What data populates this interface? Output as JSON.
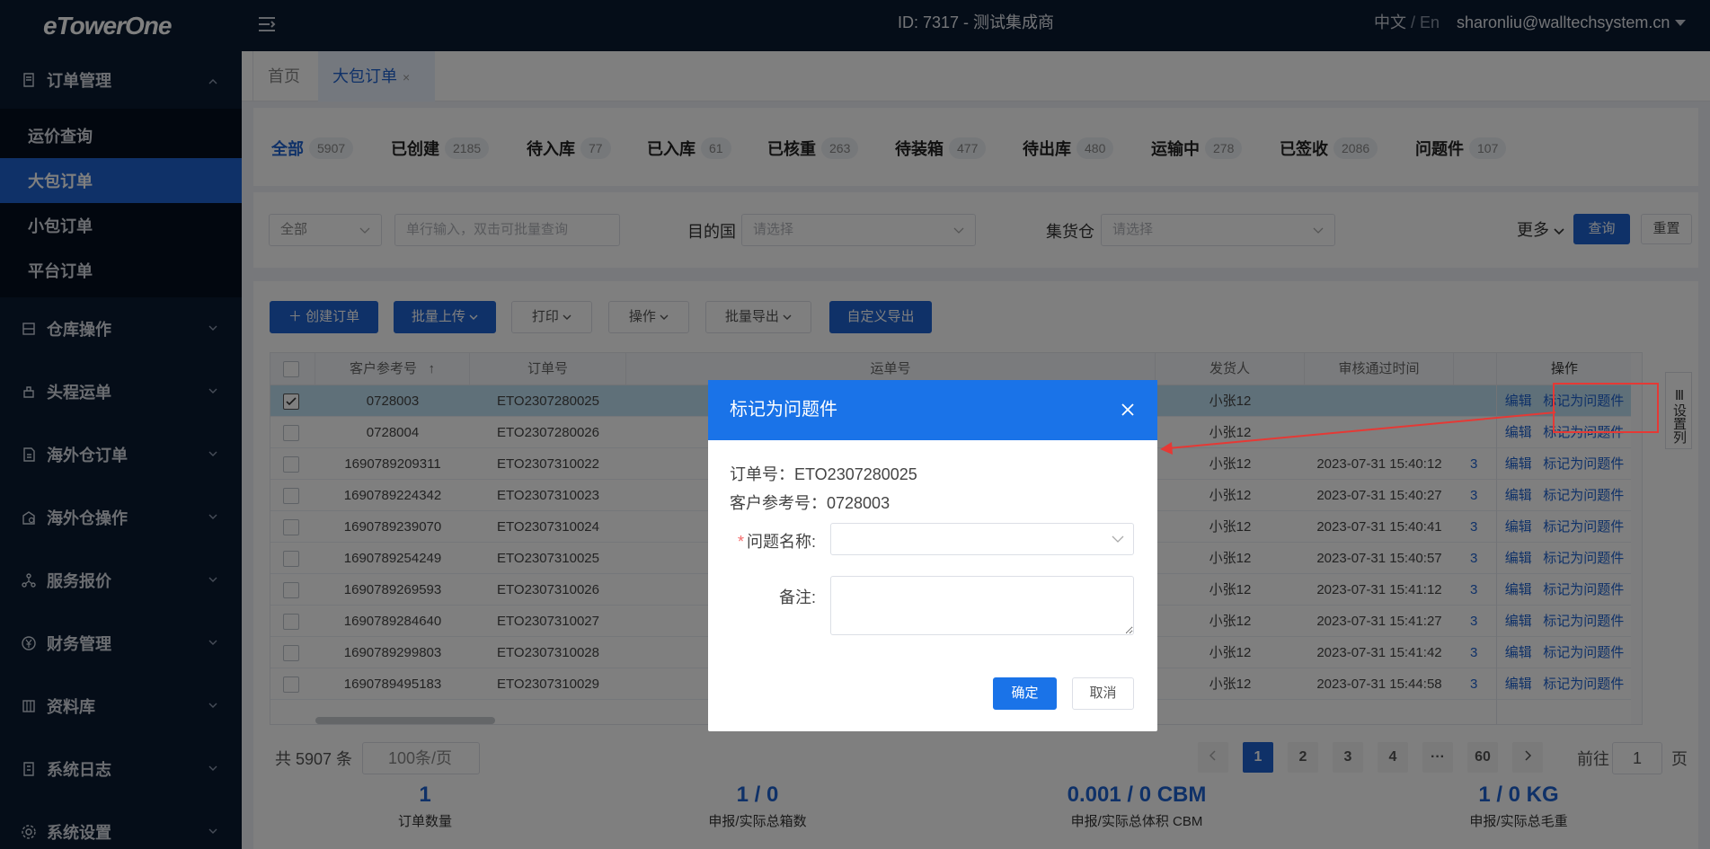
{
  "app": {
    "logo": "eTowerOne",
    "header_title": "ID: 7317 - 测试集成商",
    "lang_zh": "中文",
    "lang_sep": " / ",
    "lang_en": "En",
    "user": "sharonliu@walltechsystem.cn"
  },
  "sidebar": {
    "groups": [
      {
        "label": "订单管理",
        "icon": "receipt-icon",
        "expanded": true
      },
      {
        "label": "仓库操作",
        "icon": "warehouse-icon"
      },
      {
        "label": "头程运单",
        "icon": "ship-icon"
      },
      {
        "label": "海外仓订单",
        "icon": "document-icon"
      },
      {
        "label": "海外仓操作",
        "icon": "warehouse-ops-icon"
      },
      {
        "label": "服务报价",
        "icon": "share-icon"
      },
      {
        "label": "财务管理",
        "icon": "yen-icon"
      },
      {
        "label": "资料库",
        "icon": "database-icon"
      },
      {
        "label": "系统日志",
        "icon": "log-icon"
      },
      {
        "label": "系统设置",
        "icon": "gear-icon"
      }
    ],
    "sub_items": [
      {
        "label": "运价查询"
      },
      {
        "label": "大包订单",
        "active": true
      },
      {
        "label": "小包订单"
      },
      {
        "label": "平台订单"
      }
    ]
  },
  "tabs": {
    "home": "首页",
    "active": "大包订单",
    "close": "×"
  },
  "status_tabs": [
    {
      "label": "全部",
      "count": "5907",
      "active": true
    },
    {
      "label": "已创建",
      "count": "2185"
    },
    {
      "label": "待入库",
      "count": "77"
    },
    {
      "label": "已入库",
      "count": "61"
    },
    {
      "label": "已核重",
      "count": "263"
    },
    {
      "label": "待装箱",
      "count": "477"
    },
    {
      "label": "待出库",
      "count": "480"
    },
    {
      "label": "运输中",
      "count": "278"
    },
    {
      "label": "已签收",
      "count": "2086"
    },
    {
      "label": "问题件",
      "count": "107"
    }
  ],
  "filters": {
    "scope_value": "全部",
    "search_placeholder": "单行输入，双击可批量查询",
    "dest_label": "目的国",
    "dest_placeholder": "请选择",
    "warehouse_label": "集货仓",
    "warehouse_placeholder": "请选择",
    "more": "更多",
    "query": "查询",
    "reset": "重置"
  },
  "toolbar": {
    "create": "＋ 创建订单",
    "bulk_upload": "批量上传",
    "print": "打印",
    "operate": "操作",
    "bulk_export": "批量导出",
    "custom_export": "自定义导出"
  },
  "table": {
    "headers": {
      "ref": "客户参考号",
      "sort": "↑",
      "order": "订单号",
      "waybill": "运单号",
      "shipper": "发货人",
      "approved": "审核通过时间",
      "ops": "操作"
    },
    "rows": [
      {
        "ref": "0728003",
        "order": "ETO2307280025",
        "shipper": "小张12",
        "approved": "",
        "extra": "",
        "checked": true
      },
      {
        "ref": "0728004",
        "order": "ETO2307280026",
        "shipper": "小张12",
        "approved": "",
        "extra": ""
      },
      {
        "ref": "1690789209311",
        "order": "ETO2307310022",
        "shipper": "小张12",
        "approved": "2023-07-31 15:40:12",
        "extra": "3"
      },
      {
        "ref": "1690789224342",
        "order": "ETO2307310023",
        "shipper": "小张12",
        "approved": "2023-07-31 15:40:27",
        "extra": "3"
      },
      {
        "ref": "1690789239070",
        "order": "ETO2307310024",
        "shipper": "小张12",
        "approved": "2023-07-31 15:40:41",
        "extra": "3"
      },
      {
        "ref": "1690789254249",
        "order": "ETO2307310025",
        "shipper": "小张12",
        "approved": "2023-07-31 15:40:57",
        "extra": "3"
      },
      {
        "ref": "1690789269593",
        "order": "ETO2307310026",
        "shipper": "小张12",
        "approved": "2023-07-31 15:41:12",
        "extra": "3"
      },
      {
        "ref": "1690789284640",
        "order": "ETO2307310027",
        "shipper": "小张12",
        "approved": "2023-07-31 15:41:27",
        "extra": "3"
      },
      {
        "ref": "1690789299803",
        "order": "ETO2307310028",
        "shipper": "小张12",
        "approved": "2023-07-31 15:41:42",
        "extra": "3"
      },
      {
        "ref": "1690789495183",
        "order": "ETO2307310029",
        "shipper": "小张12",
        "approved": "2023-07-31 15:44:58",
        "extra": "3"
      }
    ],
    "edit": "编辑",
    "mark": "标记为问题件",
    "settings": "设置列"
  },
  "pagination": {
    "total": "共 5907 条",
    "page_size": "100条/页",
    "pages": [
      "1",
      "2",
      "3",
      "4",
      "···",
      "60"
    ],
    "goto": "前往",
    "goto_value": "1",
    "page_unit": "页"
  },
  "summary": [
    {
      "value": "1",
      "label": "订单数量"
    },
    {
      "value": "1 / 0",
      "label": "申报/实际总箱数"
    },
    {
      "value": "0.001 / 0 CBM",
      "label": "申报/实际总体积 CBM"
    },
    {
      "value": "1 / 0 KG",
      "label": "申报/实际总毛重"
    }
  ],
  "modal": {
    "title": "标记为问题件",
    "order_label": "订单号：",
    "order_value": "ETO2307280025",
    "ref_label": "客户参考号：",
    "ref_value": "0728003",
    "required_mark": "*",
    "problem_label": "问题名称:",
    "remark_label": "备注:",
    "ok": "确定",
    "cancel": "取消"
  },
  "colors": {
    "primary": "#1e62d0",
    "sidebar_bg": "#0a1a31",
    "annotation": "#e53935"
  }
}
